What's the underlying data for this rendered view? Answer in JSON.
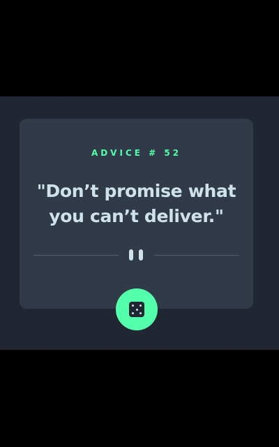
{
  "advice": {
    "label": "ADVICE # 52",
    "quote": "\"Don’t promise what you can’t deliver.\""
  },
  "colors": {
    "background_outer": "#000000",
    "background_screen": "#202632",
    "card": "#313a48",
    "accent": "#53ffaa",
    "text": "#cee3e9",
    "divider": "#4f5d74"
  },
  "icons": {
    "divider_icon": "pause-icon",
    "button_icon": "dice-icon"
  }
}
